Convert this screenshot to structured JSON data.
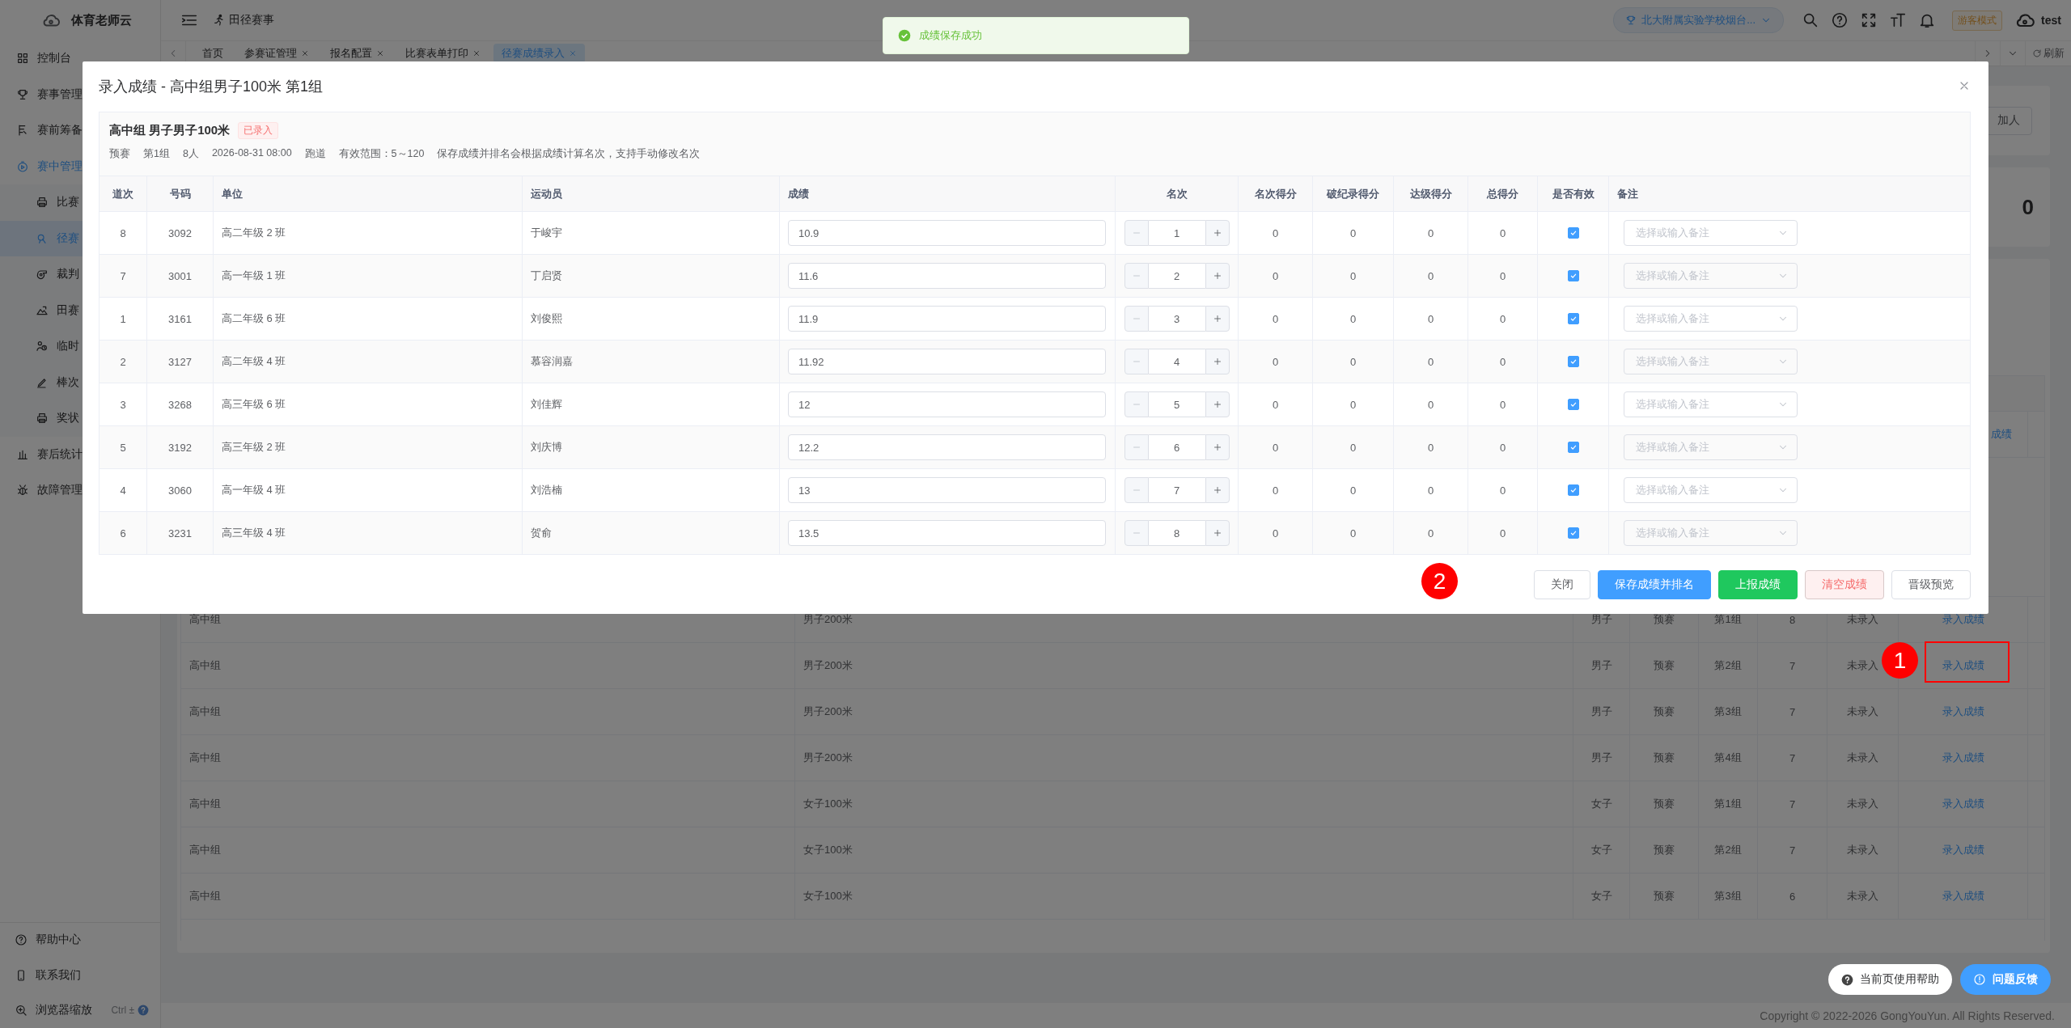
{
  "sidebar": {
    "logo": "体育老师云",
    "items": [
      {
        "label": "控制台",
        "selected": false
      },
      {
        "label": "赛事管理",
        "selected": false
      },
      {
        "label": "赛前筹备",
        "selected": false
      },
      {
        "label": "赛中管理",
        "selected": true,
        "expanded": true,
        "children": [
          {
            "label": "比赛",
            "selected": false
          },
          {
            "label": "径赛",
            "selected": true
          },
          {
            "label": "裁判",
            "selected": false
          },
          {
            "label": "田赛",
            "selected": false
          },
          {
            "label": "临时",
            "selected": false
          },
          {
            "label": "棒次",
            "selected": false
          },
          {
            "label": "奖状",
            "selected": false
          }
        ]
      },
      {
        "label": "赛后统计",
        "selected": false
      },
      {
        "label": "故障管理",
        "selected": false
      }
    ],
    "bottom_items": [
      {
        "label": "帮助中心"
      },
      {
        "label": "联系我们"
      },
      {
        "label": "浏览器缩放",
        "shortcut": "Ctrl ±"
      }
    ]
  },
  "header": {
    "section": "田径赛事",
    "school": "北大附属实验学校烟台...",
    "mode_tag": "游客模式",
    "user": "test"
  },
  "tabs": [
    {
      "label": "首页",
      "closable": false,
      "selected": false
    },
    {
      "label": "参赛证管理",
      "closable": true,
      "selected": false
    },
    {
      "label": "报名配置",
      "closable": true,
      "selected": false
    },
    {
      "label": "比赛表单打印",
      "closable": true,
      "selected": false
    },
    {
      "label": "径赛成绩录入",
      "closable": true,
      "selected": true
    }
  ],
  "tab_actions": {
    "refresh": "刷新"
  },
  "page": {
    "add_button": "加人",
    "stat_value": "0",
    "rows": [
      {
        "action": "成绩"
      },
      {
        "group": "高中组",
        "event": "男子200米",
        "gender": "男子",
        "round": "预赛",
        "heat": "第1组",
        "count": "8",
        "status": "未录入",
        "action": "录入成绩"
      },
      {
        "group": "高中组",
        "event": "男子200米",
        "gender": "男子",
        "round": "预赛",
        "heat": "第2组",
        "count": "7",
        "status": "未录入",
        "action": "录入成绩"
      },
      {
        "group": "高中组",
        "event": "男子200米",
        "gender": "男子",
        "round": "预赛",
        "heat": "第3组",
        "count": "7",
        "status": "未录入",
        "action": "录入成绩"
      },
      {
        "group": "高中组",
        "event": "男子200米",
        "gender": "男子",
        "round": "预赛",
        "heat": "第4组",
        "count": "7",
        "status": "未录入",
        "action": "录入成绩"
      },
      {
        "group": "高中组",
        "event": "女子100米",
        "gender": "女子",
        "round": "预赛",
        "heat": "第1组",
        "count": "7",
        "status": "未录入",
        "action": "录入成绩"
      },
      {
        "group": "高中组",
        "event": "女子100米",
        "gender": "女子",
        "round": "预赛",
        "heat": "第2组",
        "count": "7",
        "status": "未录入",
        "action": "录入成绩"
      },
      {
        "group": "高中组",
        "event": "女子100米",
        "gender": "女子",
        "round": "预赛",
        "heat": "第3组",
        "count": "6",
        "status": "未录入",
        "action": "录入成绩"
      }
    ]
  },
  "footer": "Copyright © 2022-2026 GongYouYun. All Rights Reserved.",
  "float_buttons": [
    {
      "label": "当前页使用帮助",
      "kind": "help"
    },
    {
      "label": "问题反馈",
      "kind": "feedback"
    }
  ],
  "toast": {
    "text": "成绩保存成功"
  },
  "dialog": {
    "title": "录入成绩 - 高中组男子100米 第1组",
    "info": {
      "title": "高中组 男子男子100米",
      "tag": "已录入",
      "meta": [
        "预赛",
        "第1组",
        "8人",
        "2026-08-31 08:00",
        "跑道",
        "有效范围：5～120",
        "保存成绩并排名会根据成绩计算名次，支持手动修改名次"
      ]
    },
    "columns": [
      "道次",
      "号码",
      "单位",
      "运动员",
      "成绩",
      "名次",
      "名次得分",
      "破纪录得分",
      "达级得分",
      "总得分",
      "是否有效",
      "备注"
    ],
    "rows": [
      {
        "lane": "8",
        "bib": "3092",
        "unit": "高二年级 2 班",
        "athlete": "于峻宇",
        "result": "10.9",
        "rank": "1",
        "rank_points": "0",
        "record_points": "0",
        "grade_points": "0",
        "total_points": "0",
        "valid": true,
        "note_placeholder": "选择或输入备注"
      },
      {
        "lane": "7",
        "bib": "3001",
        "unit": "高一年级 1 班",
        "athlete": "丁启贤",
        "result": "11.6",
        "rank": "2",
        "rank_points": "0",
        "record_points": "0",
        "grade_points": "0",
        "total_points": "0",
        "valid": true,
        "note_placeholder": "选择或输入备注"
      },
      {
        "lane": "1",
        "bib": "3161",
        "unit": "高二年级 6 班",
        "athlete": "刘俊熙",
        "result": "11.9",
        "rank": "3",
        "rank_points": "0",
        "record_points": "0",
        "grade_points": "0",
        "total_points": "0",
        "valid": true,
        "note_placeholder": "选择或输入备注"
      },
      {
        "lane": "2",
        "bib": "3127",
        "unit": "高二年级 4 班",
        "athlete": "慕容润嘉",
        "result": "11.92",
        "rank": "4",
        "rank_points": "0",
        "record_points": "0",
        "grade_points": "0",
        "total_points": "0",
        "valid": true,
        "note_placeholder": "选择或输入备注"
      },
      {
        "lane": "3",
        "bib": "3268",
        "unit": "高三年级 6 班",
        "athlete": "刘佳辉",
        "result": "12",
        "rank": "5",
        "rank_points": "0",
        "record_points": "0",
        "grade_points": "0",
        "total_points": "0",
        "valid": true,
        "note_placeholder": "选择或输入备注"
      },
      {
        "lane": "5",
        "bib": "3192",
        "unit": "高三年级 2 班",
        "athlete": "刘庆博",
        "result": "12.2",
        "rank": "6",
        "rank_points": "0",
        "record_points": "0",
        "grade_points": "0",
        "total_points": "0",
        "valid": true,
        "note_placeholder": "选择或输入备注"
      },
      {
        "lane": "4",
        "bib": "3060",
        "unit": "高一年级 4 班",
        "athlete": "刘浩楠",
        "result": "13",
        "rank": "7",
        "rank_points": "0",
        "record_points": "0",
        "grade_points": "0",
        "total_points": "0",
        "valid": true,
        "note_placeholder": "选择或输入备注"
      },
      {
        "lane": "6",
        "bib": "3231",
        "unit": "高三年级 4 班",
        "athlete": "贺俞",
        "result": "13.5",
        "rank": "8",
        "rank_points": "0",
        "record_points": "0",
        "grade_points": "0",
        "total_points": "0",
        "valid": true,
        "note_placeholder": "选择或输入备注"
      }
    ],
    "buttons": [
      {
        "label": "关闭",
        "kind": "default"
      },
      {
        "label": "保存成绩并排名",
        "kind": "primary"
      },
      {
        "label": "上报成绩",
        "kind": "success"
      },
      {
        "label": "清空成绩",
        "kind": "danger"
      },
      {
        "label": "晋级预览",
        "kind": "default"
      }
    ]
  },
  "annotations": [
    {
      "label": "1",
      "boxed": true
    },
    {
      "label": "2",
      "boxed": false
    }
  ]
}
